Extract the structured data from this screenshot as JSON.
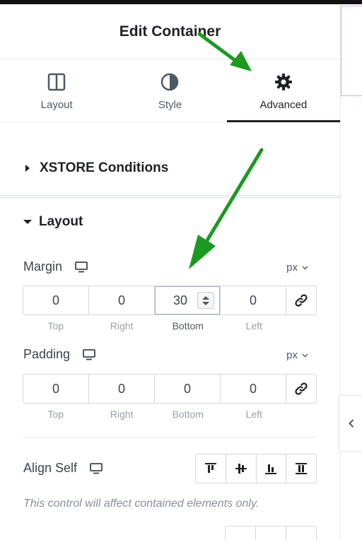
{
  "header": {
    "title": "Edit Container"
  },
  "tabs": [
    {
      "label": "Layout",
      "icon": "layout-columns-icon",
      "active": false
    },
    {
      "label": "Style",
      "icon": "half-circle-icon",
      "active": false
    },
    {
      "label": "Advanced",
      "icon": "gear-icon",
      "active": true
    }
  ],
  "sections": {
    "xstore": {
      "title": "XSTORE Conditions",
      "expanded": false
    },
    "layout": {
      "title": "Layout",
      "expanded": true
    }
  },
  "margin": {
    "label": "Margin",
    "unit": "px",
    "values": {
      "top": "0",
      "right": "0",
      "bottom": "30",
      "left": "0"
    },
    "sublabels": [
      "Top",
      "Right",
      "Bottom",
      "Left"
    ],
    "linked": true
  },
  "padding": {
    "label": "Padding",
    "unit": "px",
    "values": {
      "top": "0",
      "right": "0",
      "bottom": "0",
      "left": "0"
    },
    "sublabels": [
      "Top",
      "Right",
      "Bottom",
      "Left"
    ],
    "linked": true
  },
  "align_self": {
    "label": "Align Self",
    "options": [
      "align-start-icon",
      "align-center-icon",
      "align-end-icon",
      "align-stretch-icon"
    ]
  },
  "hint": "This control will affect contained elements only.",
  "colors": {
    "accent_arrow": "#1a9a1f",
    "text": "#1f2124",
    "border": "#d5d8dc"
  }
}
